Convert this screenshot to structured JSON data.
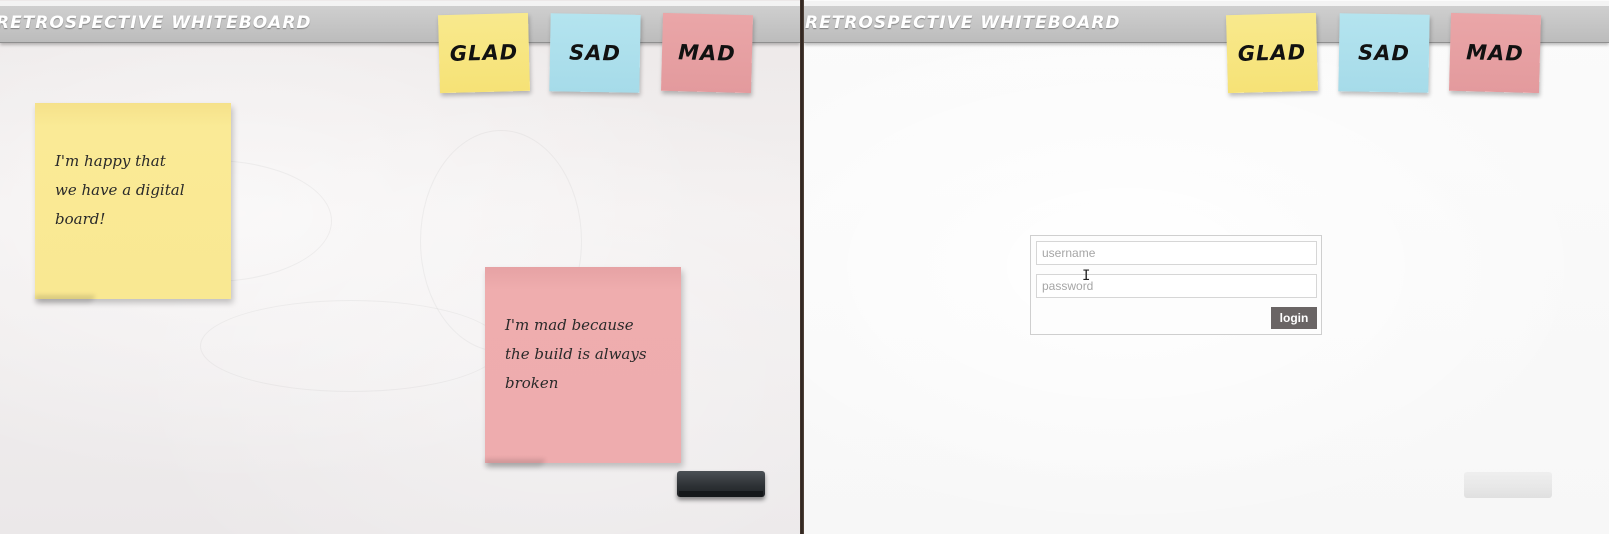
{
  "app": {
    "title": "RETROSPECTIVE WHITEBOARD"
  },
  "stacks": {
    "glad": "GLAD",
    "sad": "SAD",
    "mad": "MAD"
  },
  "colors": {
    "glad": "#f7e681",
    "sad": "#ace0ec",
    "mad": "#e6a0a2",
    "topbar": "#c6c6c6",
    "login_button": "#6a6565"
  },
  "left_board": {
    "notes": [
      {
        "color": "yellow",
        "text": "I'm happy that\nwe have a digital\nboard!"
      },
      {
        "color": "pink",
        "text": "I'm mad because\nthe build is always\nbroken"
      }
    ],
    "eraser": "eraser-icon"
  },
  "right_board": {
    "login": {
      "username_placeholder": "username",
      "password_placeholder": "password",
      "button_label": "login"
    },
    "eraser": "eraser-icon"
  }
}
